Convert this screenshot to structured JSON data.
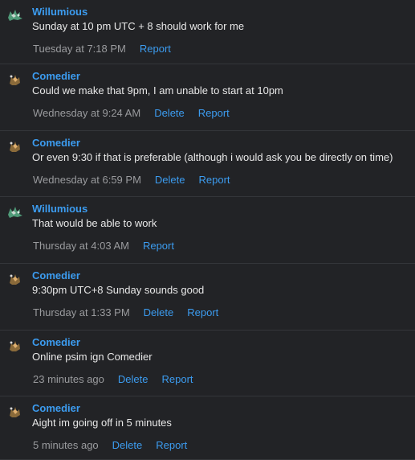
{
  "messages": [
    {
      "author": "Willumious",
      "avatar": "green-creature-avatar-icon",
      "text": "Sunday at 10 pm UTC + 8 should work for me",
      "time": "Tuesday at 7:18 PM",
      "report": "Report"
    },
    {
      "author": "Comedier",
      "avatar": "orange-creature-avatar-icon",
      "text": "Could we make that 9pm, I am unable to start at 10pm",
      "time": "Wednesday at 9:24 AM",
      "delete": "Delete",
      "report": "Report"
    },
    {
      "author": "Comedier",
      "avatar": "orange-creature-avatar-icon",
      "text": "Or even 9:30 if that is preferable (although i would ask you be directly on time)",
      "time": "Wednesday at 6:59 PM",
      "delete": "Delete",
      "report": "Report"
    },
    {
      "author": "Willumious",
      "avatar": "green-creature-avatar-icon",
      "text": "That would be able to work",
      "time": "Thursday at 4:03 AM",
      "report": "Report"
    },
    {
      "author": "Comedier",
      "avatar": "orange-creature-avatar-icon",
      "text": "9:30pm UTC+8 Sunday sounds good",
      "time": "Thursday at 1:33 PM",
      "delete": "Delete",
      "report": "Report"
    },
    {
      "author": "Comedier",
      "avatar": "orange-creature-avatar-icon",
      "text": "Online psim ign Comedier",
      "time": "23 minutes ago",
      "delete": "Delete",
      "report": "Report"
    },
    {
      "author": "Comedier",
      "avatar": "orange-creature-avatar-icon",
      "text": "Aight im going off in 5 minutes",
      "time": "5 minutes ago",
      "delete": "Delete",
      "report": "Report"
    }
  ]
}
